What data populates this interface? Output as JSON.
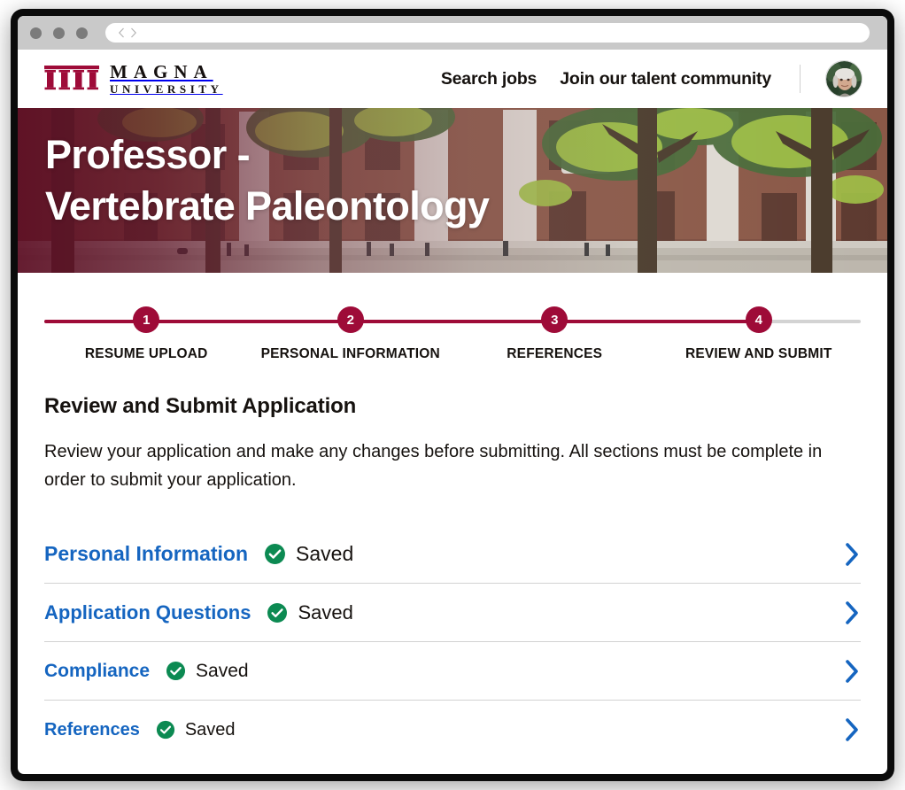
{
  "browser": {
    "back_icon": "chevron-left-icon",
    "forward_icon": "chevron-right-icon",
    "url_value": "",
    "url_placeholder": ""
  },
  "header": {
    "logo": {
      "mark": "four-columns-icon",
      "line1": "MAGNA",
      "line2": "UNIVERSITY"
    },
    "nav": [
      {
        "label": "Search jobs"
      },
      {
        "label": "Join our talent community"
      }
    ],
    "avatar_alt": "user-avatar"
  },
  "hero": {
    "title_line1": "Professor -",
    "title_line2": "Vertebrate Paleontology"
  },
  "stepper": {
    "progress_percent": 87.5,
    "steps": [
      {
        "number": "1",
        "label": "RESUME UPLOAD",
        "state": "complete"
      },
      {
        "number": "2",
        "label": "PERSONAL INFORMATION",
        "state": "complete"
      },
      {
        "number": "3",
        "label": "REFERENCES",
        "state": "complete"
      },
      {
        "number": "4",
        "label": "REVIEW AND SUBMIT",
        "state": "current"
      }
    ]
  },
  "main": {
    "title": "Review and Submit Application",
    "description": "Review your application and make any changes before submitting. All sections must be complete in order to submit your application.",
    "sections": [
      {
        "label": "Personal Information",
        "status": "Saved",
        "status_icon": "check-circle-icon",
        "chevron_icon": "chevron-right-icon"
      },
      {
        "label": "Application Questions",
        "status": "Saved",
        "status_icon": "check-circle-icon",
        "chevron_icon": "chevron-right-icon"
      },
      {
        "label": "Compliance",
        "status": "Saved",
        "status_icon": "check-circle-icon",
        "chevron_icon": "chevron-right-icon"
      },
      {
        "label": "References",
        "status": "Saved",
        "status_icon": "check-circle-icon",
        "chevron_icon": "chevron-right-icon"
      }
    ]
  },
  "colors": {
    "brand_crimson": "#9e0b38",
    "link_blue": "#1565c0",
    "status_green": "#0c8a52",
    "text_dark": "#16120f",
    "track_gray": "#d3d3d3",
    "divider_gray": "#d2d2d2"
  }
}
